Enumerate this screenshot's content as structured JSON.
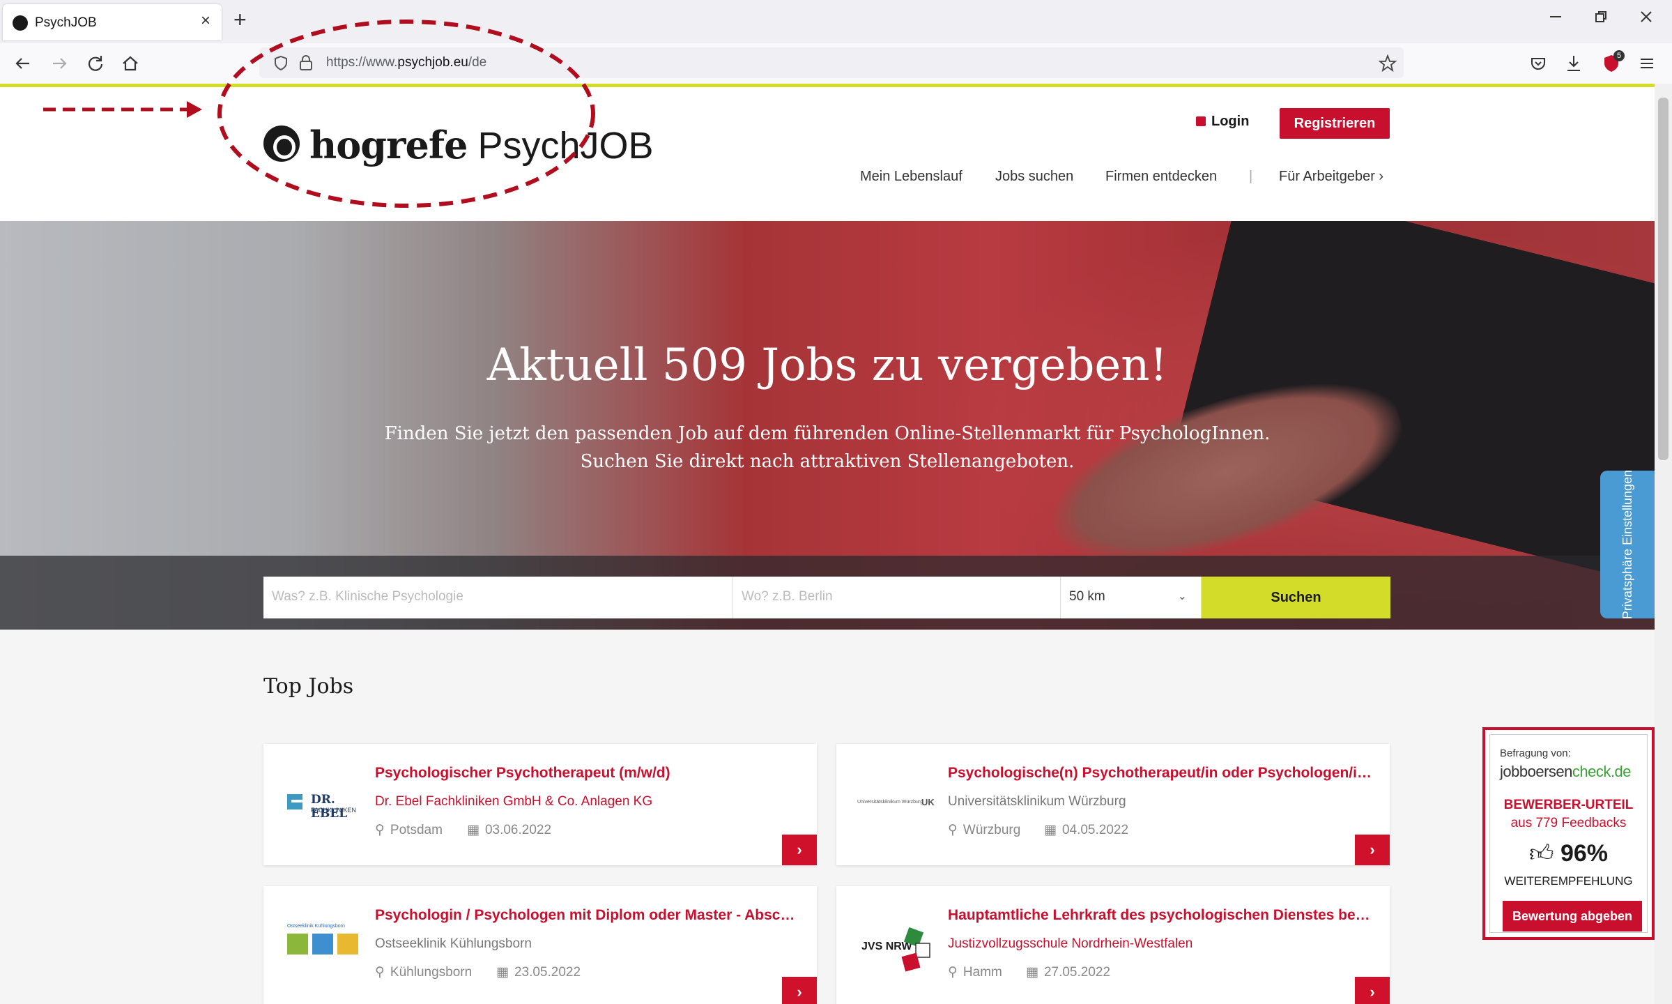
{
  "browser": {
    "tab_title": "PsychJOB",
    "tab_close": "×",
    "new_tab": "+",
    "url_prefix": "https://www.",
    "url_domain": "psychjob.eu",
    "url_path": "/de",
    "downloads_badge": "5"
  },
  "header": {
    "logo_hogrefe": "hogrefe",
    "logo_psychjob": "PsychJOB",
    "login": "Login",
    "register": "Registrieren",
    "nav": [
      "Mein Lebenslauf",
      "Jobs suchen",
      "Firmen entdecken",
      "|",
      "Für Arbeitgeber ›"
    ]
  },
  "hero": {
    "title": "Aktuell 509 Jobs zu vergeben!",
    "subtitle_1": "Finden Sie jetzt den passenden Job auf dem führenden Online-Stellenmarkt für PsychologInnen.",
    "subtitle_2": "Suchen Sie direkt nach attraktiven Stellenangeboten."
  },
  "search": {
    "what_placeholder": "Was? z.B. Klinische Psychologie",
    "where_placeholder": "Wo? z.B. Berlin",
    "radius": "50 km",
    "button": "Suchen"
  },
  "privacy_tab": "Privatsphäre Einstellungen",
  "top_jobs": {
    "title": "Top Jobs",
    "cards": [
      {
        "title": "Psychologischer Psychotherapeut (m/w/d)",
        "company": "Dr. Ebel Fachkliniken GmbH & Co. Anlagen KG",
        "location": "Potsdam",
        "date": "03.06.2022",
        "logo_text": "DR. EBEL",
        "logo_sub": "FACHKLINIKEN"
      },
      {
        "title": "Psychologische(n) Psychotherapeut/in oder Psychologen/in (Di...",
        "company": "Universitätsklinikum Würzburg",
        "location": "Würzburg",
        "date": "04.05.2022",
        "logo_text": "Universitätsklinikum Würzburg",
        "logo_sub": "UK"
      },
      {
        "title": "Psychologin / Psychologen mit Diplom oder Master - Abschluss",
        "company": "Ostseeklinik Kühlungsborn",
        "location": "Kühlungsborn",
        "date": "23.05.2022",
        "logo_text": "Ostseeklinik Kühlungsborn",
        "logo_sub": ""
      },
      {
        "title": "Hauptamtliche Lehrkraft des psychologischen Dienstes bei der...",
        "company": "Justizvollzugsschule Nordrhein-Westfalen",
        "location": "Hamm",
        "date": "27.05.2022",
        "logo_text": "JVS NRW",
        "logo_sub": ""
      }
    ]
  },
  "rating_widget": {
    "survey_by": "Befragung von:",
    "brand_a": "jobboersen",
    "brand_b": "check.de",
    "headline": "BEWERBER-URTEIL",
    "feedbacks": "aus 779 Feedbacks",
    "percent": "96%",
    "recommendation": "WEITEREMPFEHLUNG",
    "button": "Bewertung abgeben"
  },
  "colors": {
    "brand_red": "#c8102e",
    "accent_lime": "#d4dc2a",
    "annotation_red": "#b00d1e",
    "privacy_blue": "#4a9ad4"
  }
}
